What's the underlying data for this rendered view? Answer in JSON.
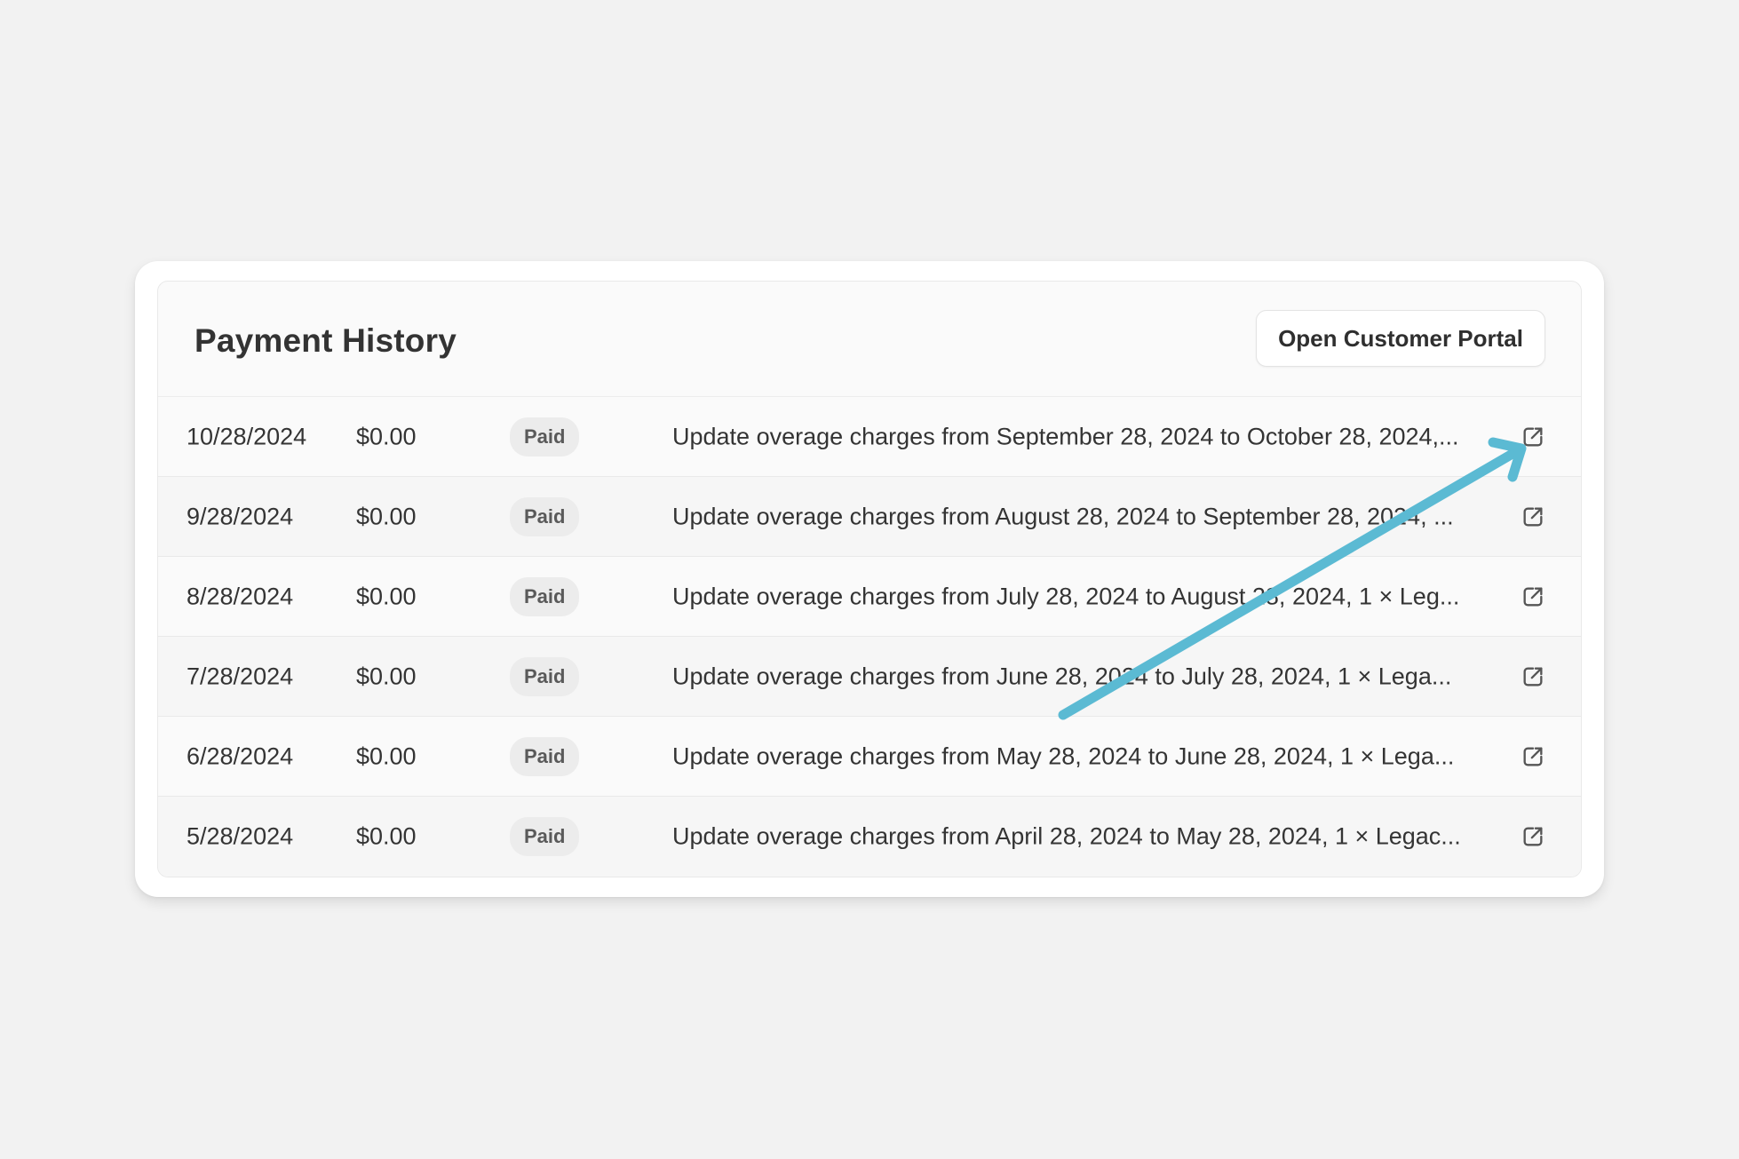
{
  "panel": {
    "title": "Payment History",
    "portal_button_label": "Open Customer Portal"
  },
  "payments": [
    {
      "date": "10/28/2024",
      "amount": "$0.00",
      "status": "Paid",
      "description": "Update overage charges from September 28, 2024 to October 28, 2024,..."
    },
    {
      "date": "9/28/2024",
      "amount": "$0.00",
      "status": "Paid",
      "description": "Update overage charges from August 28, 2024 to September 28, 2024, ..."
    },
    {
      "date": "8/28/2024",
      "amount": "$0.00",
      "status": "Paid",
      "description": "Update overage charges from July 28, 2024 to August 28, 2024, 1 × Leg..."
    },
    {
      "date": "7/28/2024",
      "amount": "$0.00",
      "status": "Paid",
      "description": "Update overage charges from June 28, 2024 to July 28, 2024, 1 × Lega..."
    },
    {
      "date": "6/28/2024",
      "amount": "$0.00",
      "status": "Paid",
      "description": "Update overage charges from May 28, 2024 to June 28, 2024, 1 × Lega..."
    },
    {
      "date": "5/28/2024",
      "amount": "$0.00",
      "status": "Paid",
      "description": "Update overage charges from April 28, 2024 to May 28, 2024, 1 × Legac..."
    }
  ],
  "icons": {
    "row_link": "external-link-icon"
  },
  "colors": {
    "annotation_arrow": "#5bbad3",
    "status_badge_bg": "#ececec",
    "page_background": "#f2f2f2"
  }
}
